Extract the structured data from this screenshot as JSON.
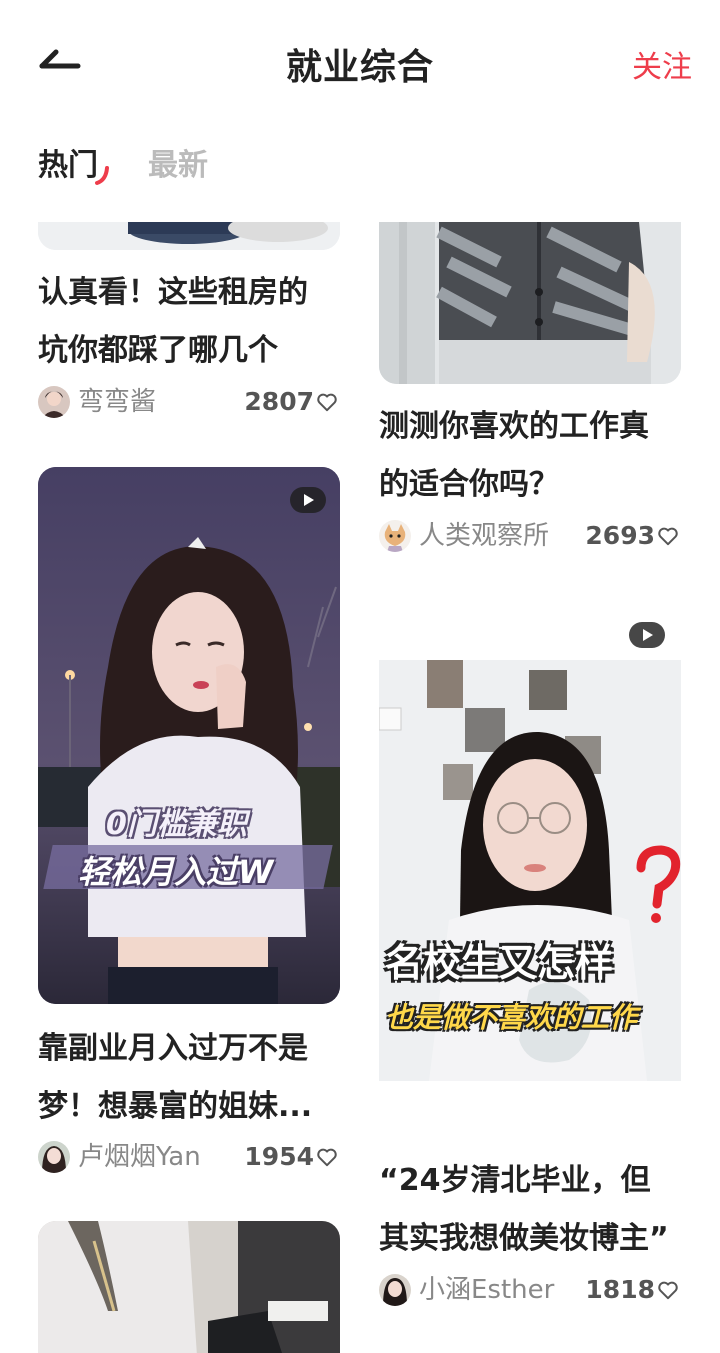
{
  "header": {
    "title": "就业综合",
    "follow_label": "关注"
  },
  "tabs": [
    {
      "label": "热门"
    },
    {
      "label": "最新"
    }
  ],
  "colors": {
    "accent": "#ee3d4b",
    "text": "#222222",
    "muted": "#888888"
  },
  "posts": [
    {
      "title_lines": [
        "认真看！这些租房的",
        "坑你都踩了哪几个"
      ],
      "author": "弯弯酱",
      "likes": "2807"
    },
    {
      "title_lines": [
        "测测你喜欢的工作真",
        "的适合你吗？"
      ],
      "author": "人类观察所",
      "likes": "2693"
    },
    {
      "title_lines": [
        "靠副业月入过万不是",
        "梦！想暴富的姐妹..."
      ],
      "author": "卢烟烟Yan",
      "likes": "1954",
      "overlay": [
        "0门槛兼职",
        "轻松月入过W"
      ],
      "video": true
    },
    {
      "title_lines": [
        "“24岁清北毕业，但",
        "其实我想做美妆博主”"
      ],
      "author": "小涵Esther",
      "likes": "1818",
      "overlay": [
        "名校生又怎样",
        "也是做不喜欢的工作"
      ],
      "video": true
    }
  ]
}
